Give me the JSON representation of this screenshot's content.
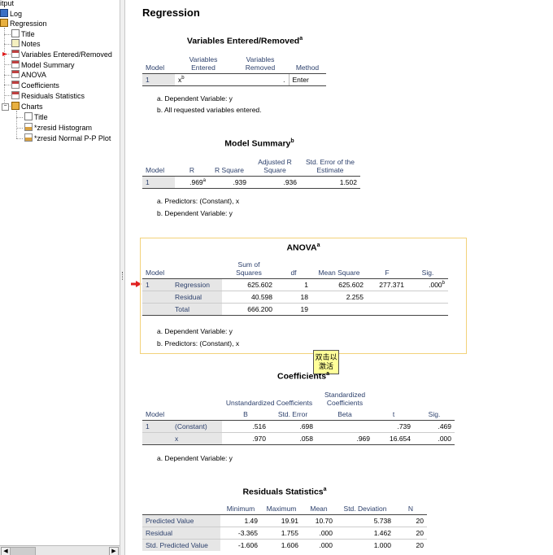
{
  "outline": {
    "root_label": "itput",
    "log_label": "Log",
    "regression_label": "Regression",
    "items": [
      "Title",
      "Notes",
      "Variables Entered/Removed",
      "Model Summary",
      "ANOVA",
      "Coefficients",
      "Residuals Statistics"
    ],
    "charts_label": "Charts",
    "chart_items": [
      "Title",
      "*zresid Histogram",
      "*zresid Normal P-P Plot"
    ],
    "toggle_minus": "−"
  },
  "scroll": {
    "left": "◀",
    "right": "▶"
  },
  "output": {
    "heading": "Regression",
    "vars_table": {
      "title": "Variables Entered/Removed",
      "title_sup": "a",
      "headers": [
        "Model",
        "Variables Entered",
        "Variables Removed",
        "Method"
      ],
      "row": {
        "model": "1",
        "entered": "x",
        "entered_sup": "b",
        "removed": ".",
        "method": "Enter"
      },
      "footnotes": [
        "a. Dependent Variable: y",
        "b. All requested variables entered."
      ]
    },
    "model_summary": {
      "title": "Model Summary",
      "title_sup": "b",
      "headers": [
        "Model",
        "R",
        "R Square",
        "Adjusted R Square",
        "Std. Error of the Estimate"
      ],
      "row": {
        "model": "1",
        "r": ".969",
        "r_sup": "a",
        "r2": ".939",
        "adj_r2": ".936",
        "se": "1.502"
      },
      "footnotes": [
        "a. Predictors: (Constant), x",
        "b. Dependent Variable: y"
      ]
    },
    "anova": {
      "title": "ANOVA",
      "title_sup": "a",
      "headers": [
        "Model",
        "Sum of Squares",
        "df",
        "Mean Square",
        "F",
        "Sig."
      ],
      "model": "1",
      "rows": [
        {
          "label": "Regression",
          "ss": "625.602",
          "df": "1",
          "ms": "625.602",
          "f": "277.371",
          "sig": ".000",
          "sig_sup": "b"
        },
        {
          "label": "Residual",
          "ss": "40.598",
          "df": "18",
          "ms": "2.255",
          "f": "",
          "sig": "",
          "sig_sup": ""
        },
        {
          "label": "Total",
          "ss": "666.200",
          "df": "19",
          "ms": "",
          "f": "",
          "sig": "",
          "sig_sup": ""
        }
      ],
      "footnotes": [
        "a. Dependent Variable: y",
        "b. Predictors: (Constant), x"
      ]
    },
    "tooltip": {
      "line1": "双击以",
      "line2": "激活"
    },
    "coefficients": {
      "title": "Coefficients",
      "title_sup": "a",
      "group_unstd": "Unstandardized Coefficients",
      "group_std": "Standardized Coefficients",
      "headers": [
        "Model",
        "B",
        "Std. Error",
        "Beta",
        "t",
        "Sig."
      ],
      "model": "1",
      "rows": [
        {
          "label": "(Constant)",
          "b": ".516",
          "se": ".698",
          "beta": "",
          "t": ".739",
          "sig": ".469"
        },
        {
          "label": "x",
          "b": ".970",
          "se": ".058",
          "beta": ".969",
          "t": "16.654",
          "sig": ".000"
        }
      ],
      "footnotes": [
        "a. Dependent Variable: y"
      ]
    },
    "residuals": {
      "title": "Residuals Statistics",
      "title_sup": "a",
      "headers": [
        "Minimum",
        "Maximum",
        "Mean",
        "Std. Deviation",
        "N"
      ],
      "rows": [
        {
          "label": "Predicted Value",
          "min": "1.49",
          "max": "19.91",
          "mean": "10.70",
          "sd": "5.738",
          "n": "20"
        },
        {
          "label": "Residual",
          "min": "-3.365",
          "max": "1.755",
          "mean": ".000",
          "sd": "1.462",
          "n": "20"
        },
        {
          "label": "Std. Predicted Value",
          "min": "-1.606",
          "max": "1.606",
          "mean": ".000",
          "sd": "1.000",
          "n": "20"
        }
      ]
    }
  }
}
